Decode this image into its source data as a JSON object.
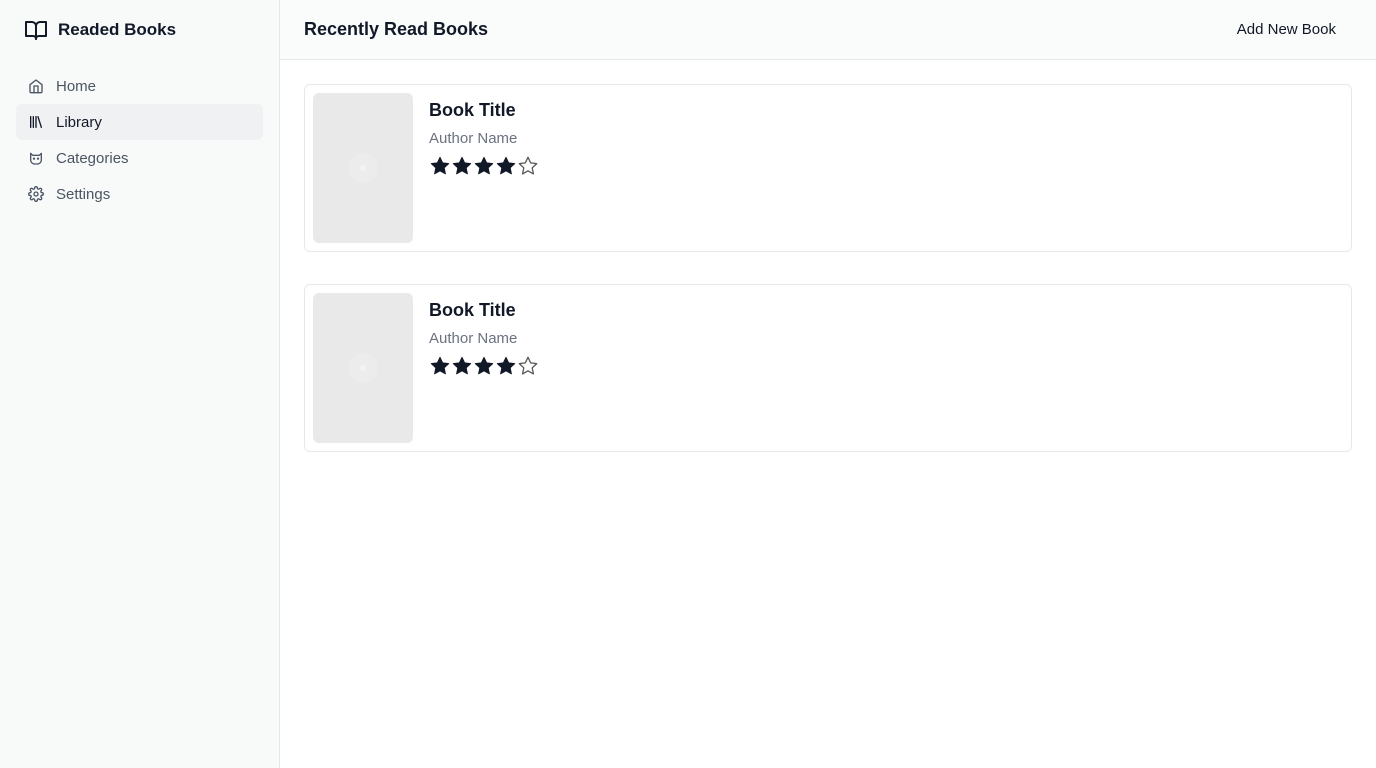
{
  "app": {
    "title": "Readed Books",
    "icon": "book-open-icon"
  },
  "sidebar": {
    "items": [
      {
        "label": "Home",
        "icon": "home-icon",
        "active": false
      },
      {
        "label": "Library",
        "icon": "library-icon",
        "active": true
      },
      {
        "label": "Categories",
        "icon": "categories-icon",
        "active": false
      },
      {
        "label": "Settings",
        "icon": "gear-icon",
        "active": false
      }
    ]
  },
  "header": {
    "title": "Recently Read Books",
    "add_button_label": "Add New Book"
  },
  "books": [
    {
      "title": "Book Title",
      "author": "Author Name",
      "rating": 4,
      "max_rating": 5
    },
    {
      "title": "Book Title",
      "author": "Author Name",
      "rating": 4,
      "max_rating": 5
    }
  ],
  "colors": {
    "sidebar_bg": "#f8faf9",
    "active_item_bg": "#f0f1f3",
    "star_filled": "#111827",
    "border": "#e5e7eb"
  }
}
